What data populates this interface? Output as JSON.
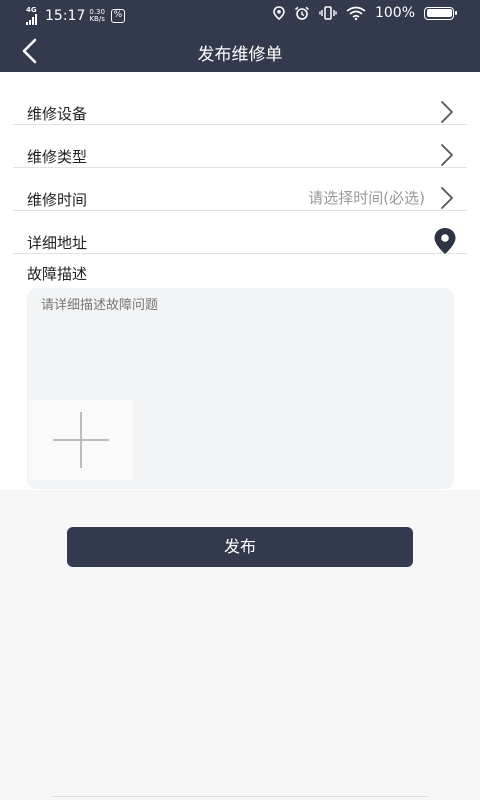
{
  "status_bar": {
    "network": "4G",
    "time": "15:17",
    "speed_value": "0.30",
    "speed_unit": "KB/s",
    "battery": "100%"
  },
  "header": {
    "title": "发布维修单",
    "back_icon": "chevron-left-icon"
  },
  "form": {
    "rows": [
      {
        "label": "维修设备",
        "icon": "chevron-right-icon"
      },
      {
        "label": "维修类型",
        "icon": "chevron-right-icon"
      },
      {
        "label": "维修时间",
        "hint": "请选择时间(必选)",
        "icon": "chevron-right-icon"
      },
      {
        "label": "详细地址",
        "icon": "location-pin-icon"
      }
    ],
    "description": {
      "label": "故障描述",
      "placeholder": "请详细描述故障问题"
    },
    "add_photo_icon": "plus-icon"
  },
  "actions": {
    "publish_label": "发布"
  },
  "colors": {
    "header_bg": "#343a4d",
    "button_bg": "#343a4d",
    "text": "#222222",
    "hint": "#9a9a9a"
  }
}
